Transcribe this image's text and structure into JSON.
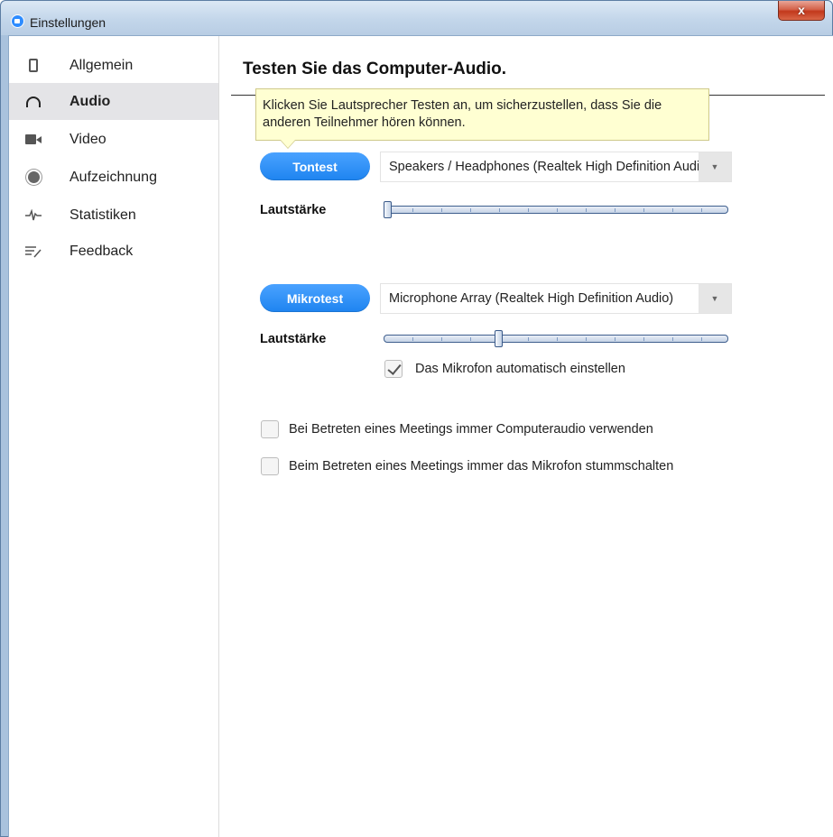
{
  "window": {
    "title": "Einstellungen",
    "close_label": "x"
  },
  "sidebar": {
    "items": [
      {
        "label": "Allgemein",
        "icon": "phone-icon",
        "active": false
      },
      {
        "label": "Audio",
        "icon": "headphones-icon",
        "active": true
      },
      {
        "label": "Video",
        "icon": "video-camera-icon",
        "active": false
      },
      {
        "label": "Aufzeichnung",
        "icon": "record-icon",
        "active": false
      },
      {
        "label": "Statistiken",
        "icon": "pulse-icon",
        "active": false
      },
      {
        "label": "Feedback",
        "icon": "feedback-icon",
        "active": false
      }
    ]
  },
  "main": {
    "title": "Testen Sie das Computer-Audio.",
    "tooltip": "Klicken Sie Lautsprecher Testen an, um sicherzustellen, dass Sie die anderen Teilnehmer hören können.",
    "speaker": {
      "test_button": "Tontest",
      "device": "Speakers / Headphones (Realtek High Definition Audio)",
      "volume_label": "Lautstärke",
      "volume_level": 0.0
    },
    "microphone": {
      "test_button": "Mikrotest",
      "device": "Microphone Array (Realtek High Definition Audio)",
      "volume_label": "Lautstärke",
      "volume_level": 0.33,
      "auto_adjust_label": "Das Mikrofon automatisch einstellen",
      "auto_adjust_checked": true
    },
    "options": [
      {
        "label": "Bei Betreten eines Meetings immer Computeraudio verwenden",
        "checked": false
      },
      {
        "label": "Beim Betreten eines Meetings immer das Mikrofon stummschalten",
        "checked": false
      }
    ]
  },
  "colors": {
    "accent": "#2d8cff",
    "sidebar_active": "#e4e4e7",
    "tooltip_bg": "#ffffd2"
  }
}
